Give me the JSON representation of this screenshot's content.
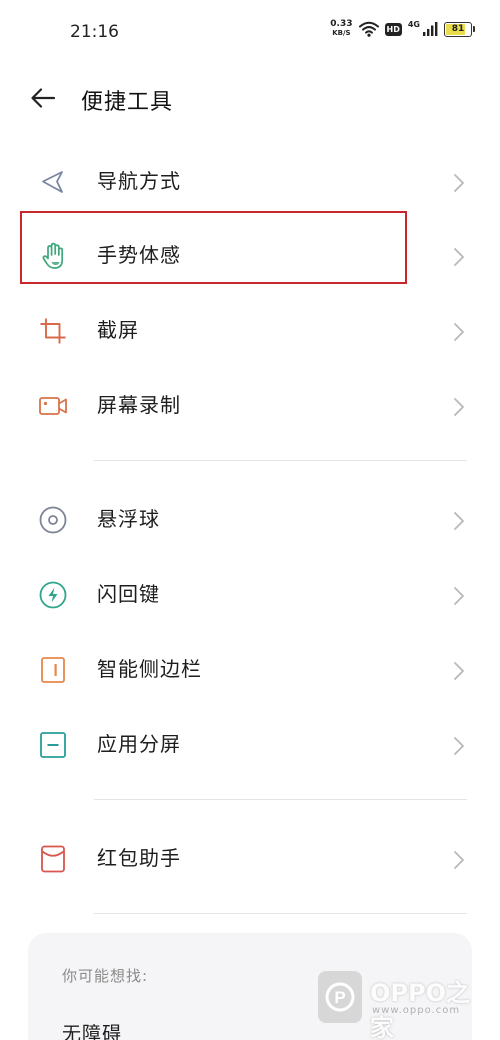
{
  "status_bar": {
    "time": "21:16",
    "net_speed_value": "0.33",
    "net_speed_unit": "KB/S",
    "hd_label": "HD",
    "signal_type": "4G",
    "battery_level": "81",
    "battery_fraction": 0.81
  },
  "header": {
    "back_icon": "arrow-left-icon",
    "title": "便捷工具"
  },
  "menu": {
    "items": [
      {
        "label": "导航方式",
        "icon": "navigation-arrow-icon",
        "icon_color": "#7a86a3"
      },
      {
        "label": "手势体感",
        "icon": "hand-gesture-icon",
        "icon_color": "#3fa77c",
        "highlighted": true
      },
      {
        "label": "截屏",
        "icon": "crop-screenshot-icon",
        "icon_color": "#d86a4a"
      },
      {
        "label": "屏幕录制",
        "icon": "screen-record-icon",
        "icon_color": "#d8734a"
      },
      {
        "label": "悬浮球",
        "icon": "floating-ball-icon",
        "icon_color": "#7d8494"
      },
      {
        "label": "闪回键",
        "icon": "flash-back-icon",
        "icon_color": "#2fa58e"
      },
      {
        "label": "智能侧边栏",
        "icon": "smart-sidebar-icon",
        "icon_color": "#e7874a"
      },
      {
        "label": "应用分屏",
        "icon": "split-screen-icon",
        "icon_color": "#2a9d9a"
      },
      {
        "label": "红包助手",
        "icon": "red-envelope-icon",
        "icon_color": "#d8564e"
      }
    ]
  },
  "suggestions": {
    "title": "你可能想找:",
    "items": [
      "无障碍"
    ]
  },
  "watermark": {
    "brand": "OPPO之家",
    "url": "www.oppo.com",
    "logo_letter": "P"
  },
  "colors": {
    "highlight_border": "#c8282c",
    "chevron": "#b8b8b8",
    "divider": "#e4e4e4"
  }
}
